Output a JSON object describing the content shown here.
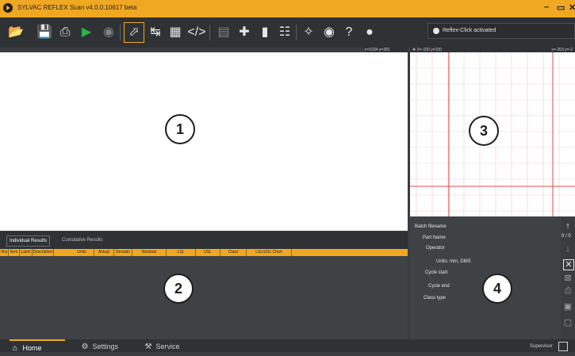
{
  "window": {
    "title": "SYLVAC REFLEX Scan v4.0.0.10617 beta",
    "minimize": "–",
    "maximize": "▭",
    "close": "✕"
  },
  "toolbar": {
    "buttons": [
      "folder-open",
      "save",
      "print",
      "play",
      "stop",
      "profile",
      "loop",
      "grid",
      "code",
      "ruler",
      "crosshair",
      "bar",
      "align",
      "target",
      "eye",
      "help",
      "rocket"
    ]
  },
  "notification": {
    "text": "Reflex-Click activated"
  },
  "views": {
    "view1": {
      "coords": "x=1034 y=281",
      "badge": "1"
    },
    "view3": {
      "coords_left": "✚ X=-100 y=100",
      "coords_right": "x=-263 y=-2",
      "badge": "3"
    }
  },
  "results": {
    "tabs": [
      "Individual Results",
      "Cumulative Results"
    ],
    "columns": [
      "Visi",
      "Item",
      "Label",
      "Description",
      "Units",
      "Actual",
      "Deviatio",
      "Nominal",
      "LSL",
      "USL",
      "Class",
      "LSL/USL Chart"
    ],
    "badge": "2"
  },
  "details": {
    "fields": [
      "Batch filename",
      "Part Name",
      "Operator",
      "Units: mm, DMS",
      "Cycle start",
      "Cycle end",
      "Class type"
    ],
    "badge": "4",
    "counter": "0 / 0"
  },
  "nav": {
    "items": [
      "Home",
      "Settings",
      "Service"
    ],
    "user": "Supervisor"
  }
}
